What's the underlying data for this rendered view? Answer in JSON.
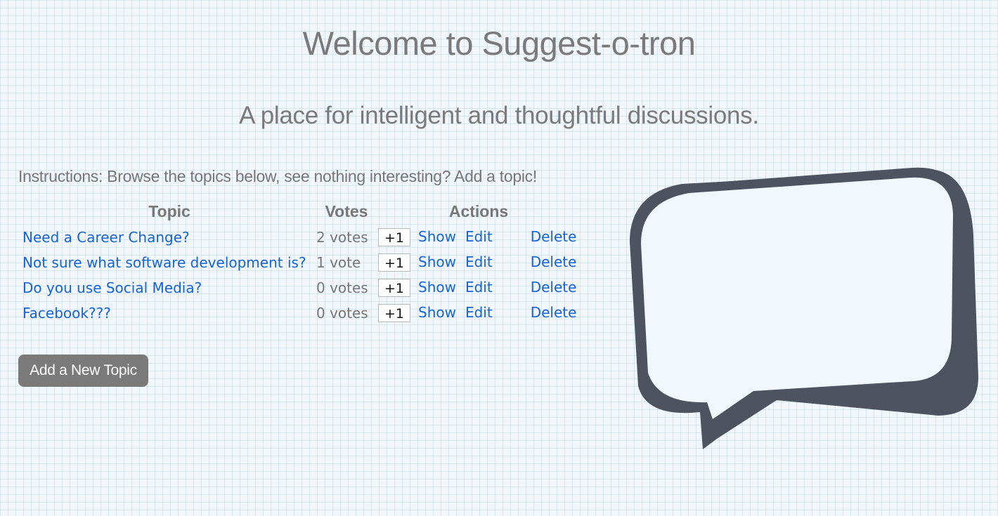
{
  "header": {
    "title": "Welcome to Suggest-o-tron",
    "subtitle": "A place for intelligent and thoughtful discussions."
  },
  "instructions": "Instructions: Browse the topics below, see nothing interesting? Add a topic!",
  "table": {
    "columns": [
      "Topic",
      "Votes",
      "Actions"
    ],
    "rows": [
      {
        "topic": "Need a Career Change?",
        "votes": "2 votes",
        "plus": "+1",
        "show": "Show",
        "edit": "Edit",
        "delete": "Delete"
      },
      {
        "topic": "Not sure what software development is?",
        "votes": "1 vote",
        "plus": "+1",
        "show": "Show",
        "edit": "Edit",
        "delete": "Delete"
      },
      {
        "topic": "Do you use Social Media?",
        "votes": "0 votes",
        "plus": "+1",
        "show": "Show",
        "edit": "Edit",
        "delete": "Delete"
      },
      {
        "topic": "Facebook???",
        "votes": "0 votes",
        "plus": "+1",
        "show": "Show",
        "edit": "Edit",
        "delete": "Delete"
      }
    ]
  },
  "add_button_label": "Add a New Topic",
  "decor": {
    "bubble_icon": "speech-bubble-icon",
    "bubble_color": "#4e5360"
  },
  "colors": {
    "link": "#1664d8",
    "text": "#777777",
    "button_bg": "#7a7a7a"
  }
}
